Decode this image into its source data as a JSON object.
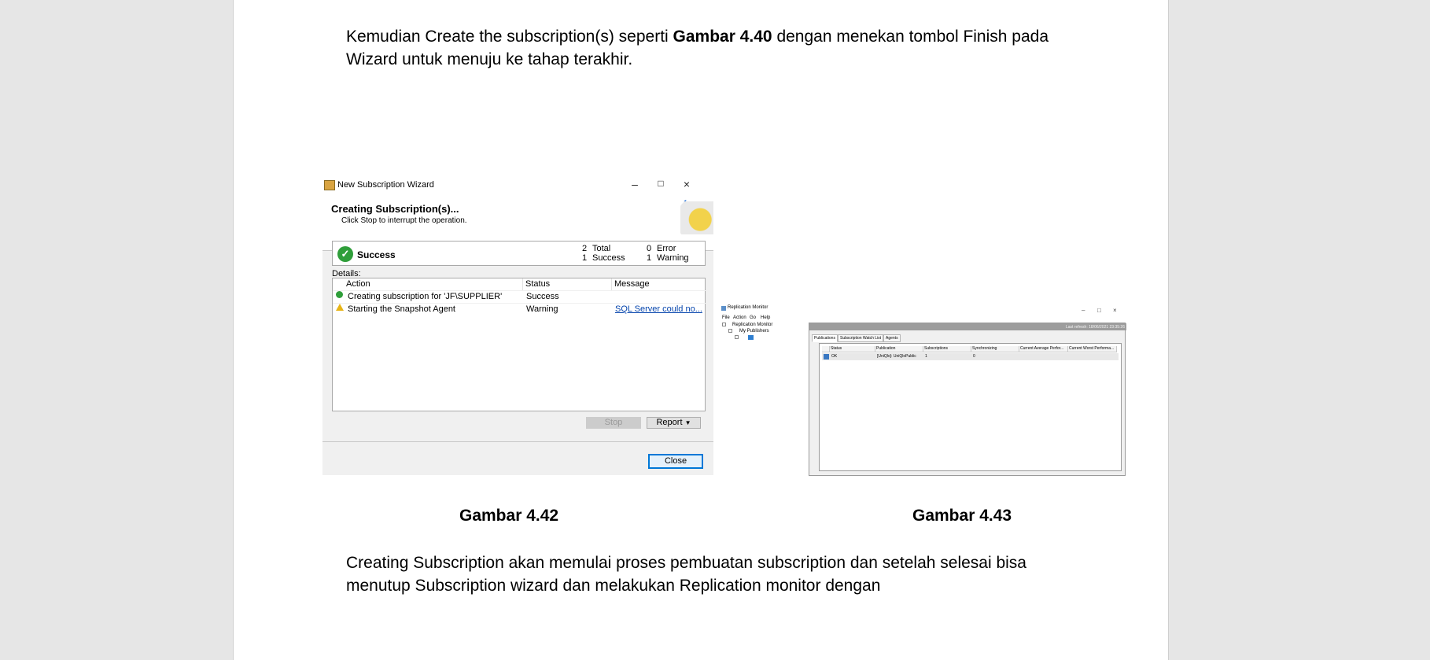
{
  "document": {
    "para1_part1": "Kemudian Create the subscription(s) seperti ",
    "para1_bold": "Gambar 4.40",
    "para1_part2": " dengan menekan tombol Finish pada Wizard untuk menuju ke tahap terakhir.",
    "caption1": "Gambar 4.42",
    "caption2": "Gambar 4.43",
    "para2": "Creating Subscription akan memulai proses pembuatan subscription dan setelah selesai bisa menutup Subscription wizard dan melakukan Replication monitor dengan"
  },
  "wizard": {
    "window_title": "New Subscription Wizard",
    "heading": "Creating Subscription(s)...",
    "subheading": "Click Stop to interrupt the operation.",
    "status": "Success",
    "total_count": "2",
    "total_label": "Total",
    "success_count": "1",
    "success_label": "Success",
    "error_count": "0",
    "error_label": "Error",
    "warning_count": "1",
    "warning_label": "Warning",
    "details_label": "Details:",
    "columns": [
      "Action",
      "Status",
      "Message"
    ],
    "rows": [
      {
        "action": "Creating subscription for 'JF\\SUPPLIER'",
        "status": "Success",
        "message": ""
      },
      {
        "action": "Starting the Snapshot Agent",
        "status": "Warning",
        "message": "SQL Server could no..."
      }
    ],
    "stop_label": "Stop",
    "report_label": "Report",
    "close_label": "Close",
    "icons": {
      "success": "check-circle-icon",
      "warning": "warning-icon",
      "minimize": "minimize-icon",
      "maximize": "maximize-icon",
      "close": "close-icon"
    }
  },
  "replication_monitor": {
    "window_title": "Replication Monitor",
    "menu": [
      "File",
      "Action",
      "Go",
      "Help"
    ],
    "tree_root": "Replication Monitor",
    "tree_child": "My Publishers",
    "last_refresh": "Last refresh: 18/06/2021 23:35:26",
    "tabs": [
      "Publications",
      "Subscription Watch List",
      "Agents"
    ],
    "columns": [
      "Status",
      "Publication",
      "Subscriptions",
      "Synchronizing",
      "Current Average Perfor...",
      "Current Worst Performa..."
    ],
    "row": {
      "status": "OK",
      "publication": "[UniQlo]: UniQloPublic",
      "subscriptions": "1",
      "synchronizing": "0"
    }
  }
}
